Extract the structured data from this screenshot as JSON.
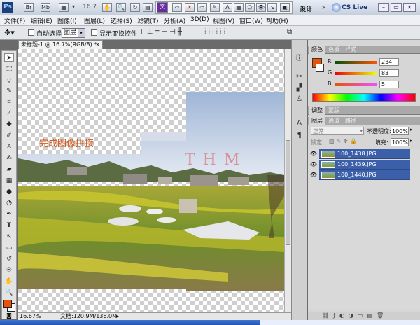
{
  "appbar": {
    "zoom": "16.7",
    "workspace": "设计",
    "cslive": "CS Live"
  },
  "menu": [
    "文件(F)",
    "编辑(E)",
    "图像(I)",
    "图层(L)",
    "选择(S)",
    "滤镜(T)",
    "分析(A)",
    "3D(D)",
    "视图(V)",
    "窗口(W)",
    "帮助(H)"
  ],
  "options": {
    "auto_select_label": "自动选择:",
    "auto_select_value": "图层",
    "transform_label": "显示变换控件"
  },
  "document": {
    "tab_title": "未标题-1 @ 16.7%(RGB/8) *",
    "caption": "完成图像拼接",
    "watermark": "T H M"
  },
  "status": {
    "zoom": "16.67%",
    "doc": "文档:120.9M/136.0M"
  },
  "color_panel": {
    "tabs": [
      "颜色",
      "色板",
      "样式"
    ],
    "r_label": "R",
    "r_value": "234",
    "g_label": "G",
    "g_value": "83",
    "b_label": "B",
    "b_value": "5",
    "swatch": "#ea5305"
  },
  "adjust_tabs": [
    "调整",
    "蒙版"
  ],
  "layers_panel": {
    "tabs": [
      "图层",
      "通道",
      "路径"
    ],
    "blend_mode": "正常",
    "opacity_label": "不透明度:",
    "opacity_value": "100%",
    "lock_label": "锁定:",
    "fill_label": "填充:",
    "fill_value": "100%",
    "layers": [
      {
        "name": "100_1438.JPG"
      },
      {
        "name": "100_1439.JPG"
      },
      {
        "name": "100_1440.JPG"
      }
    ]
  }
}
